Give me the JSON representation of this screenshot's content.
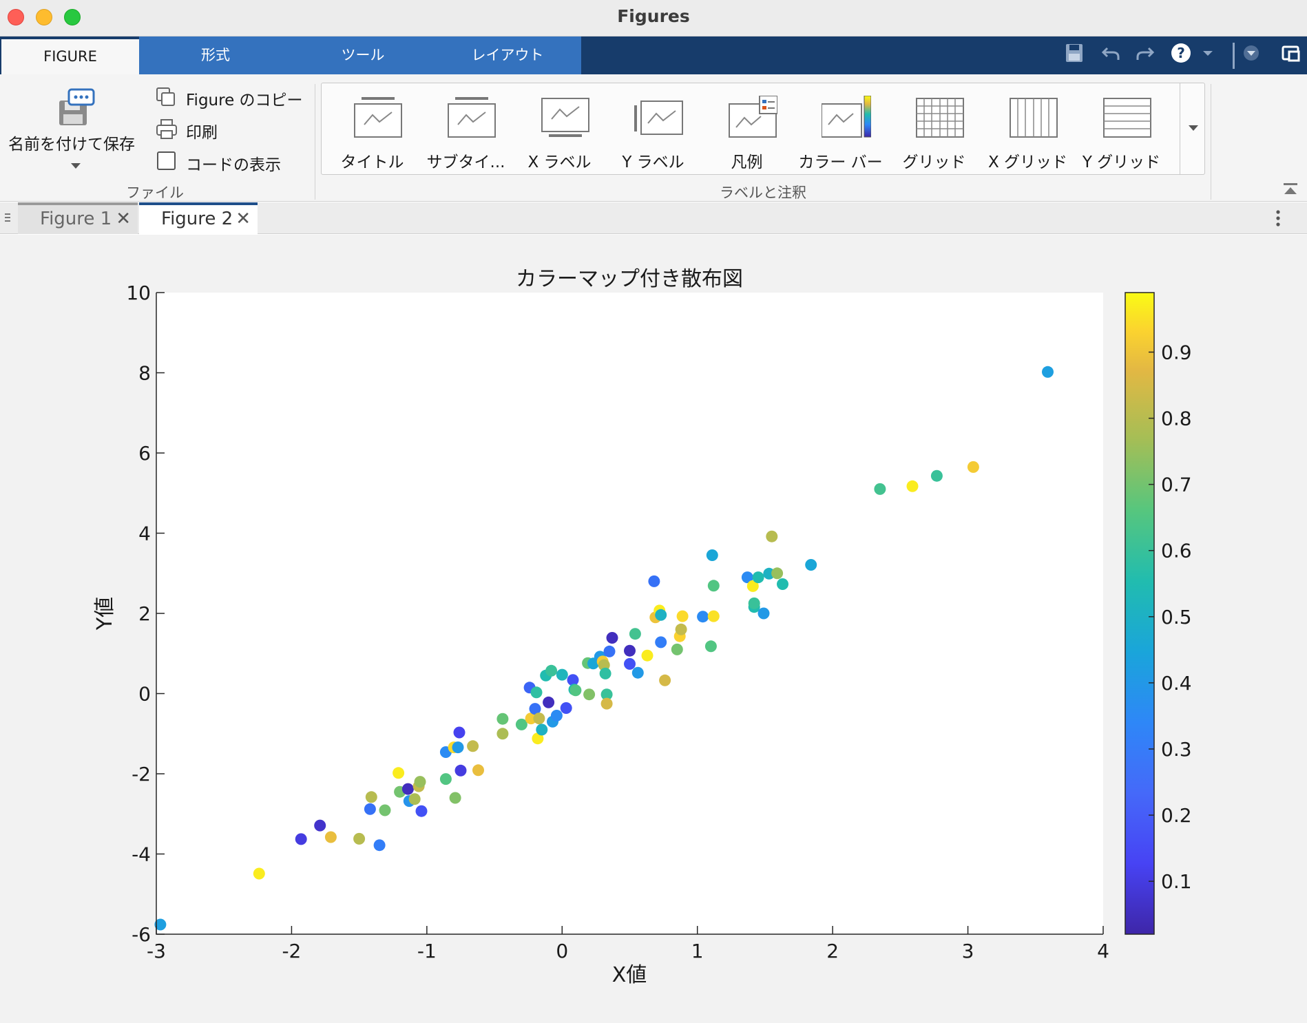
{
  "window": {
    "title": "Figures"
  },
  "ribbon_tabs": [
    "FIGURE",
    "形式",
    "ツール",
    "レイアウト"
  ],
  "file_section": {
    "save_as_label": "名前を付けて保存",
    "copy_figure_label": "Figure のコピー",
    "print_label": "印刷",
    "show_code_label": "コードの表示",
    "section_label": "ファイル"
  },
  "labels_section": {
    "items": [
      "タイトル",
      "サブタイ...",
      "X ラベル",
      "Y ラベル",
      "凡例",
      "カラー バー",
      "グリッド",
      "X グリッド",
      "Y グリッド"
    ],
    "section_label": "ラベルと注釈"
  },
  "figure_tabs": [
    "Figure 1",
    "Figure 2"
  ],
  "active_figure_tab": "Figure 2",
  "icons": [
    "save-icon",
    "undo-icon",
    "redo-icon",
    "help-icon",
    "dropdown-icon",
    "undock-icon",
    "copy-icon",
    "print-icon",
    "checkbox-icon",
    "more-icon",
    "collapse-ribbon-icon"
  ],
  "colormap": [
    "#3e26a8",
    "#4743f4",
    "#2e87f7",
    "#1aa5da",
    "#21bcaf",
    "#56c67e",
    "#a4be56",
    "#e3b843",
    "#fbd32f",
    "#f9fb15"
  ],
  "chart_data": {
    "type": "scatter",
    "title": "カラーマップ付き散布図",
    "xlabel": "X値",
    "ylabel": "Y値",
    "xlim": [
      -3,
      4
    ],
    "ylim": [
      -6,
      10
    ],
    "xticks": [
      "-3",
      "-2",
      "-1",
      "0",
      "1",
      "2",
      "3",
      "4"
    ],
    "yticks": [
      "-6",
      "-4",
      "-2",
      "0",
      "2",
      "4",
      "6",
      "8",
      "10"
    ],
    "colorbar": {
      "range": [
        0.02,
        0.99
      ],
      "ticks": [
        "0.1",
        "0.2",
        "0.3",
        "0.4",
        "0.5",
        "0.6",
        "0.7",
        "0.8",
        "0.9"
      ]
    },
    "grid": false,
    "points": [
      [
        -2.97,
        -5.76,
        0.32
      ],
      [
        -2.24,
        -4.49,
        0.95
      ],
      [
        -1.93,
        -3.63,
        0.1
      ],
      [
        -1.79,
        -3.29,
        0.07
      ],
      [
        -1.71,
        -3.58,
        0.8
      ],
      [
        -1.5,
        -3.62,
        0.7
      ],
      [
        -1.42,
        -2.88,
        0.2
      ],
      [
        -1.41,
        -2.58,
        0.7
      ],
      [
        -1.35,
        -3.78,
        0.22
      ],
      [
        -1.31,
        -2.91,
        0.6
      ],
      [
        -1.21,
        -1.98,
        0.95
      ],
      [
        -1.2,
        -2.45,
        0.6
      ],
      [
        -1.14,
        -2.38,
        0.05
      ],
      [
        -1.13,
        -2.68,
        0.28
      ],
      [
        -1.09,
        -2.63,
        0.68
      ],
      [
        -1.06,
        -2.31,
        0.72
      ],
      [
        -1.05,
        -2.2,
        0.65
      ],
      [
        -1.04,
        -2.93,
        0.15
      ],
      [
        -0.86,
        -1.46,
        0.25
      ],
      [
        -0.86,
        -2.13,
        0.55
      ],
      [
        -0.8,
        -1.34,
        0.9
      ],
      [
        -0.79,
        -2.6,
        0.62
      ],
      [
        -0.77,
        -1.34,
        0.3
      ],
      [
        -0.76,
        -0.97,
        0.12
      ],
      [
        -0.75,
        -1.92,
        0.1
      ],
      [
        -0.66,
        -1.31,
        0.72
      ],
      [
        -0.62,
        -1.91,
        0.8
      ],
      [
        -0.44,
        -1.0,
        0.68
      ],
      [
        -0.44,
        -0.63,
        0.58
      ],
      [
        -0.3,
        -0.77,
        0.55
      ],
      [
        -0.24,
        0.15,
        0.18
      ],
      [
        -0.23,
        -0.62,
        0.85
      ],
      [
        -0.2,
        -0.38,
        0.2
      ],
      [
        -0.19,
        0.03,
        0.48
      ],
      [
        -0.18,
        -1.12,
        0.95
      ],
      [
        -0.17,
        -0.62,
        0.72
      ],
      [
        -0.15,
        -0.9,
        0.4
      ],
      [
        -0.12,
        0.45,
        0.45
      ],
      [
        -0.1,
        -0.22,
        0.05
      ],
      [
        -0.08,
        0.57,
        0.5
      ],
      [
        -0.07,
        -0.7,
        0.3
      ],
      [
        -0.04,
        -0.55,
        0.25
      ],
      [
        0.0,
        0.47,
        0.42
      ],
      [
        0.03,
        -0.36,
        0.15
      ],
      [
        0.08,
        0.34,
        0.15
      ],
      [
        0.09,
        0.1,
        0.45
      ],
      [
        0.1,
        0.08,
        0.55
      ],
      [
        0.19,
        0.76,
        0.58
      ],
      [
        0.2,
        -0.02,
        0.62
      ],
      [
        0.23,
        0.75,
        0.35
      ],
      [
        0.28,
        0.92,
        0.3
      ],
      [
        0.3,
        0.8,
        0.85
      ],
      [
        0.31,
        0.71,
        0.7
      ],
      [
        0.32,
        0.5,
        0.48
      ],
      [
        0.33,
        -0.02,
        0.5
      ],
      [
        0.33,
        -0.25,
        0.75
      ],
      [
        0.35,
        1.05,
        0.2
      ],
      [
        0.37,
        1.39,
        0.05
      ],
      [
        0.5,
        1.07,
        0.05
      ],
      [
        0.5,
        0.74,
        0.15
      ],
      [
        0.54,
        1.49,
        0.52
      ],
      [
        0.56,
        0.52,
        0.3
      ],
      [
        0.63,
        0.95,
        0.95
      ],
      [
        0.68,
        2.8,
        0.2
      ],
      [
        0.69,
        1.9,
        0.82
      ],
      [
        0.72,
        2.07,
        0.95
      ],
      [
        0.73,
        1.96,
        0.4
      ],
      [
        0.73,
        1.28,
        0.22
      ],
      [
        0.76,
        0.33,
        0.75
      ],
      [
        0.85,
        1.1,
        0.6
      ],
      [
        0.87,
        1.43,
        0.88
      ],
      [
        0.88,
        1.6,
        0.72
      ],
      [
        0.89,
        1.93,
        0.9
      ],
      [
        1.04,
        1.92,
        0.25
      ],
      [
        1.1,
        1.18,
        0.55
      ],
      [
        1.11,
        3.45,
        0.35
      ],
      [
        1.12,
        2.69,
        0.55
      ],
      [
        1.12,
        1.93,
        0.92
      ],
      [
        1.37,
        2.9,
        0.25
      ],
      [
        1.41,
        2.68,
        0.95
      ],
      [
        1.42,
        2.16,
        0.45
      ],
      [
        1.42,
        2.25,
        0.5
      ],
      [
        1.45,
        2.9,
        0.45
      ],
      [
        1.49,
        2.0,
        0.3
      ],
      [
        1.53,
        2.99,
        0.4
      ],
      [
        1.55,
        3.92,
        0.7
      ],
      [
        1.59,
        3.0,
        0.65
      ],
      [
        1.63,
        2.73,
        0.45
      ],
      [
        1.84,
        3.21,
        0.35
      ],
      [
        2.35,
        5.1,
        0.52
      ],
      [
        2.59,
        5.17,
        0.95
      ],
      [
        2.77,
        5.43,
        0.5
      ],
      [
        3.04,
        5.65,
        0.85
      ],
      [
        3.59,
        8.02,
        0.32
      ]
    ]
  }
}
